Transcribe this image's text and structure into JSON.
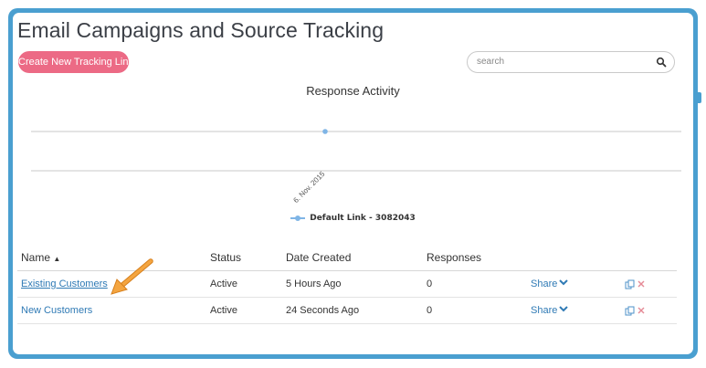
{
  "header": {
    "title": "Email Campaigns and Source Tracking",
    "create_button": "Create New Tracking Link"
  },
  "search": {
    "placeholder": "search",
    "value": ""
  },
  "chart_data": {
    "type": "line",
    "title": "Response Activity",
    "categories": [
      "6. Nov. 2015"
    ],
    "series": [
      {
        "name": "Default Link - 3082043",
        "values": [
          0
        ]
      }
    ],
    "legend_position": "bottom-center",
    "grid": true,
    "colors": {
      "series": "#7fb5e6"
    }
  },
  "table": {
    "columns": [
      "Name",
      "Status",
      "Date Created",
      "Responses"
    ],
    "sort_indicator": "▲",
    "rows": [
      {
        "name": "Existing Customers",
        "status": "Active",
        "date_created": "5 Hours Ago",
        "responses": "0",
        "share": "Share"
      },
      {
        "name": "New Customers",
        "status": "Active",
        "date_created": "24 Seconds Ago",
        "responses": "0",
        "share": "Share"
      }
    ]
  },
  "icons": [
    "search-icon",
    "sort-up-icon",
    "chevron-down-icon",
    "copy-icon",
    "delete-icon",
    "annotation-arrow-icon"
  ],
  "colors": {
    "frame": "#4a9fd0",
    "accent_button": "#ec6a85",
    "link": "#2f7ab5",
    "annotation_arrow": "#f39c34"
  }
}
